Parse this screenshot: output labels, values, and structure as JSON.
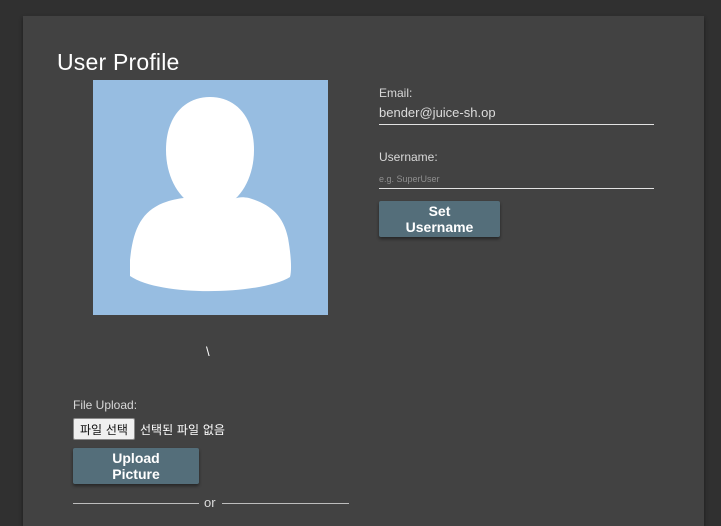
{
  "page": {
    "title": "User Profile"
  },
  "profile": {
    "avatar_icon": "person-silhouette-icon",
    "caption": "\\"
  },
  "email": {
    "label": "Email:",
    "value": "bender@juice-sh.op"
  },
  "username": {
    "label": "Username:",
    "placeholder": "e.g. SuperUser",
    "value": "",
    "button_label": "Set Username"
  },
  "upload": {
    "label": "File Upload:",
    "choose_button_label": "파일 선택",
    "status_text": "선택된 파일 없음",
    "button_label": "Upload Picture"
  },
  "divider": {
    "text": "or"
  },
  "colors": {
    "page_background": "#303030",
    "card_background": "#424242",
    "avatar_background": "#97bde1",
    "button_background": "#546e7a"
  }
}
